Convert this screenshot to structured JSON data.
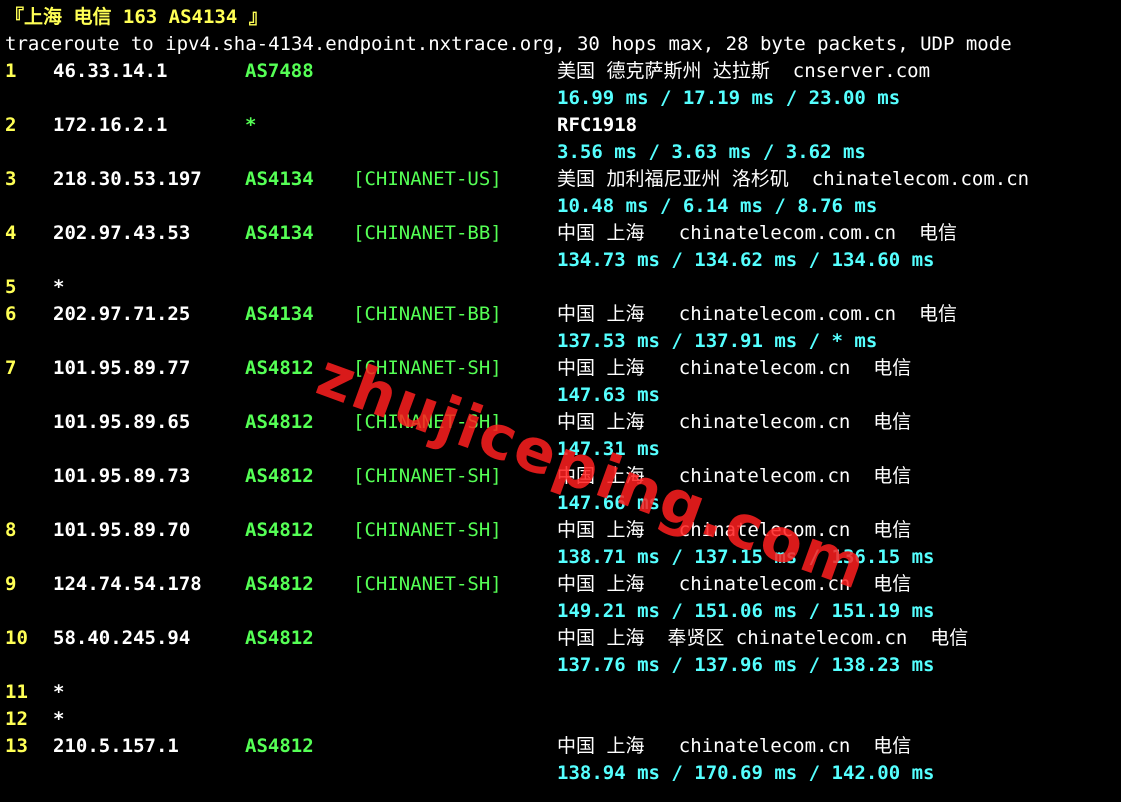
{
  "header": {
    "title": "『上海 电信 163 AS4134 』",
    "command": "traceroute to ipv4.sha-4134.endpoint.nxtrace.org, 30 hops max, 28 byte packets, UDP mode"
  },
  "colors": {
    "background": "#000000",
    "hop_number": "#ffff55",
    "ip": "#ffffff",
    "asn": "#55ff55",
    "rtt": "#55ffff",
    "watermark": "#ff1e1e"
  },
  "watermark": "zhujiceping.com",
  "rows": [
    {
      "hop": "1",
      "ip": "46.33.14.1",
      "asn": "AS7488",
      "net": "",
      "geo": "美国 德克萨斯州 达拉斯  cnserver.com",
      "rtt": "16.99 ms / 17.19 ms / 23.00 ms"
    },
    {
      "hop": "2",
      "ip": "172.16.2.1",
      "asn": "*",
      "net": "",
      "geo": "RFC1918",
      "rtt": "3.56 ms / 3.63 ms / 3.62 ms"
    },
    {
      "hop": "3",
      "ip": "218.30.53.197",
      "asn": "AS4134",
      "net": "[CHINANET-US]",
      "geo": "美国 加利福尼亚州 洛杉矶  chinatelecom.com.cn",
      "rtt": "10.48 ms / 6.14 ms / 8.76 ms"
    },
    {
      "hop": "4",
      "ip": "202.97.43.53",
      "asn": "AS4134",
      "net": "[CHINANET-BB]",
      "geo": "中国 上海   chinatelecom.com.cn  电信",
      "rtt": "134.73 ms / 134.62 ms / 134.60 ms"
    },
    {
      "hop": "5",
      "ip": "*",
      "asn": "",
      "net": "",
      "geo": "",
      "rtt": ""
    },
    {
      "hop": "6",
      "ip": "202.97.71.25",
      "asn": "AS4134",
      "net": "[CHINANET-BB]",
      "geo": "中国 上海   chinatelecom.com.cn  电信",
      "rtt": "137.53 ms / 137.91 ms / * ms"
    },
    {
      "hop": "7",
      "ip": "101.95.89.77",
      "asn": "AS4812",
      "net": "[CHINANET-SH]",
      "geo": "中国 上海   chinatelecom.cn  电信",
      "rtt": "147.63 ms"
    },
    {
      "hop": "",
      "ip": "101.95.89.65",
      "asn": "AS4812",
      "net": "[CHINANET-SH]",
      "geo": "中国 上海   chinatelecom.cn  电信",
      "rtt": "147.31 ms"
    },
    {
      "hop": "",
      "ip": "101.95.89.73",
      "asn": "AS4812",
      "net": "[CHINANET-SH]",
      "geo": "中国 上海   chinatelecom.cn  电信",
      "rtt": "147.66 ms"
    },
    {
      "hop": "8",
      "ip": "101.95.89.70",
      "asn": "AS4812",
      "net": "[CHINANET-SH]",
      "geo": "中国 上海   chinatelecom.cn  电信",
      "rtt": "138.71 ms / 137.15 ms / 136.15 ms"
    },
    {
      "hop": "9",
      "ip": "124.74.54.178",
      "asn": "AS4812",
      "net": "[CHINANET-SH]",
      "geo": "中国 上海   chinatelecom.cn  电信",
      "rtt": "149.21 ms / 151.06 ms / 151.19 ms"
    },
    {
      "hop": "10",
      "ip": "58.40.245.94",
      "asn": "AS4812",
      "net": "",
      "geo": "中国 上海  奉贤区 chinatelecom.cn  电信",
      "rtt": "137.76 ms / 137.96 ms / 138.23 ms"
    },
    {
      "hop": "11",
      "ip": "*",
      "asn": "",
      "net": "",
      "geo": "",
      "rtt": ""
    },
    {
      "hop": "12",
      "ip": "*",
      "asn": "",
      "net": "",
      "geo": "",
      "rtt": ""
    },
    {
      "hop": "13",
      "ip": "210.5.157.1",
      "asn": "AS4812",
      "net": "",
      "geo": "中国 上海   chinatelecom.cn  电信",
      "rtt": "138.94 ms / 170.69 ms / 142.00 ms"
    }
  ]
}
